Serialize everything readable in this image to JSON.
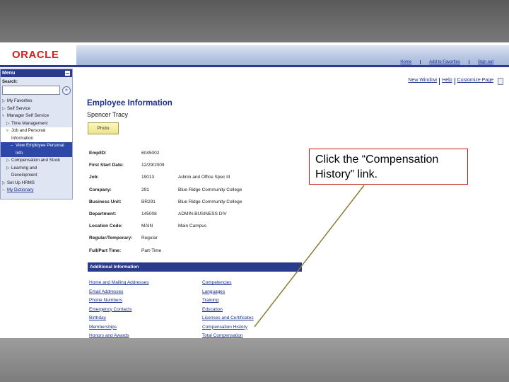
{
  "header": {
    "logo": "ORACLE",
    "links": [
      "Home",
      "Add to Favorites",
      "Sign out"
    ]
  },
  "page_links": [
    "New Window",
    "Help",
    "Customize Page"
  ],
  "menu": {
    "title": "Menu",
    "search_label": "Search:",
    "search_value": "",
    "items": [
      {
        "label": "My Favorites",
        "arrow": "▷"
      },
      {
        "label": "Self Service",
        "arrow": "▷"
      },
      {
        "label": "Manager Self Service",
        "arrow": "▿"
      },
      {
        "label": "Time Management",
        "arrow": "▷"
      },
      {
        "label": "Job and Personal",
        "arrow": "▿"
      },
      {
        "label": "Information",
        "arrow": ""
      },
      {
        "label": "View Employee Personal",
        "arrow": "–"
      },
      {
        "label": "Info",
        "arrow": ""
      },
      {
        "label": "Compensation and Stock",
        "arrow": "▷"
      },
      {
        "label": "Learning and",
        "arrow": "▷"
      },
      {
        "label": "Development",
        "arrow": ""
      },
      {
        "label": "Set Up HRMS",
        "arrow": "▷"
      },
      {
        "label": "My Dictionary",
        "arrow": "–"
      }
    ]
  },
  "main": {
    "title": "Employee Information",
    "employee_name": "Spencer Tracy",
    "photo_button": "Photo",
    "fields": [
      {
        "label": "EmplID:",
        "value": "6045002",
        "desc": ""
      },
      {
        "label": "First Start Date:",
        "value": "12/29/2009",
        "desc": ""
      },
      {
        "label": "Job:",
        "value": "19013",
        "desc": "Admin and Office Spec III"
      },
      {
        "label": "Company:",
        "value": "291",
        "desc": "Blue Ridge Community College"
      },
      {
        "label": "Business Unit:",
        "value": "BR291",
        "desc": "Blue Ridge Community College"
      },
      {
        "label": "Department:",
        "value": "145008",
        "desc": "ADMIN-BUSINESS DIV"
      },
      {
        "label": "Location Code:",
        "value": "MAIN",
        "desc": "Main Campus"
      },
      {
        "label": "Regular/Temporary:",
        "value": "Regular",
        "desc": ""
      },
      {
        "label": "Full/Part Time:",
        "value": "Part-Time",
        "desc": ""
      }
    ],
    "additional_title": "Additional Information",
    "links_left": [
      "Home and Mailing Addresses",
      "Email Addresses",
      "Phone Numbers",
      "Emergency Contacts",
      "Birthday",
      "Memberships",
      "Honors and Awards"
    ],
    "links_right": [
      "Competencies",
      "Languages",
      "Training",
      "Education",
      "Licenses and Certificates",
      "Compensation History",
      "Total Compensation"
    ]
  },
  "callout": {
    "text": "Click the “Compensation History” link."
  }
}
